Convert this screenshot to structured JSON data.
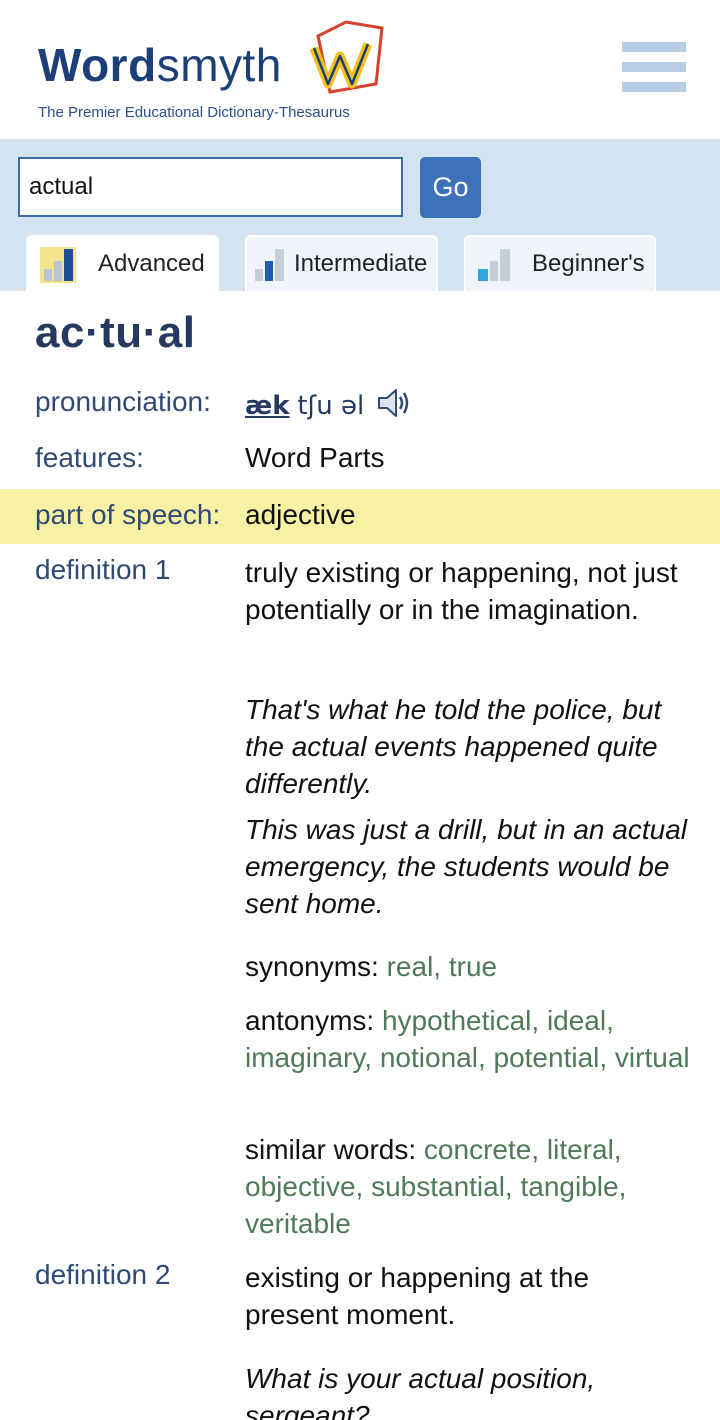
{
  "header": {
    "logo_bold": "Word",
    "logo_light": "smyth",
    "tagline": "The Premier Educational Dictionary-Thesaurus",
    "menu_icon": "hamburger-menu-icon"
  },
  "search": {
    "value": "actual",
    "go_label": "Go"
  },
  "tabs": [
    {
      "label": "Advanced",
      "active": true
    },
    {
      "label": "Intermediate",
      "active": false
    },
    {
      "label": "Beginner's",
      "active": false
    }
  ],
  "entry": {
    "headword": "ac·tu·al",
    "pronunciation_label": "pronunciation:",
    "pronunciation_stressed": "æk",
    "pronunciation_rest": "tʃu əl",
    "features_label": "features:",
    "features_value": "Word Parts",
    "pos_label": "part of speech:",
    "pos_value": "adjective",
    "definitions": [
      {
        "label": "definition 1",
        "text": "truly existing or happening, not just potentially or in the imagination.",
        "examples": [
          "That's what he told the police, but the actual events happened quite differently.",
          "This was just a drill, but in an actual emergency, the students would be sent home."
        ],
        "synonyms_label": "synonyms:",
        "synonyms": "real, true",
        "antonyms_label": "antonyms:",
        "antonyms": "hypothetical, ideal, imaginary, notional, potential, virtual",
        "similar_label": "similar words:",
        "similar": "concrete, literal, objective, substantial, tangible, veritable"
      },
      {
        "label": "definition 2",
        "text": "existing or happening at the present moment.",
        "examples": [
          "What is your actual position, sergeant?"
        ]
      }
    ]
  },
  "colors": {
    "brand_blue": "#1d3f78",
    "band_blue": "#d3e3ef",
    "go_button": "#3d72b9",
    "pos_highlight": "#f7f1a5",
    "nym_green": "#4f7a5a"
  }
}
